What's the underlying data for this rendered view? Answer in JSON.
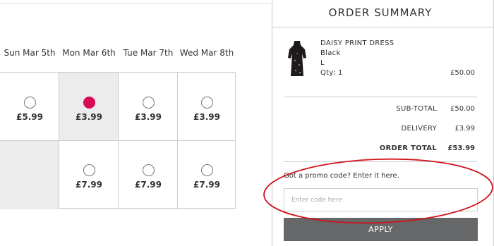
{
  "delivery": {
    "days": [
      "Sun Mar 5th",
      "Mon Mar 6th",
      "Tue Mar 7th",
      "Wed Mar 8th"
    ],
    "row1": [
      {
        "price": "£5.99",
        "selected": false
      },
      {
        "price": "£3.99",
        "selected": true
      },
      {
        "price": "£3.99",
        "selected": false
      },
      {
        "price": "£3.99",
        "selected": false
      }
    ],
    "row2": [
      {
        "price": "",
        "available": false
      },
      {
        "price": "£7.99",
        "selected": false
      },
      {
        "price": "£7.99",
        "selected": false
      },
      {
        "price": "£7.99",
        "selected": false
      }
    ],
    "selected_color": "#d90a56"
  },
  "summary": {
    "title": "ORDER SUMMARY",
    "item": {
      "name": "DAISY PRINT DRESS",
      "color": "Black",
      "size": "L",
      "qty": "Qty: 1",
      "price": "£50.00"
    },
    "subtotal_label": "SUB-TOTAL",
    "subtotal": "£50.00",
    "delivery_label": "DELIVERY",
    "delivery": "£3.99",
    "total_label": "ORDER TOTAL",
    "total": "£53.99",
    "promo_label": "Got a promo code? Enter it here.",
    "promo_placeholder": "Enter code here",
    "apply_label": "APPLY",
    "annotation_color": "#d0121b"
  }
}
